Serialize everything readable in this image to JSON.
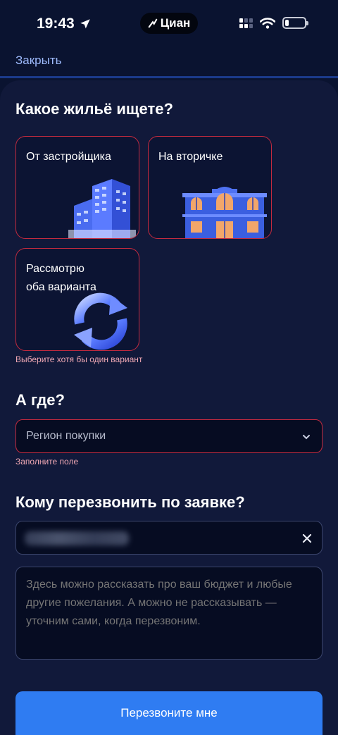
{
  "status_bar": {
    "time": "19:43",
    "app_name": "Циан",
    "icons": [
      "location-arrow-icon",
      "signal-icon",
      "wifi-icon",
      "battery-icon"
    ],
    "battery_level": 0.2
  },
  "header": {
    "close_label": "Закрыть"
  },
  "housing": {
    "title": "Какое жильё ищете?",
    "options": [
      {
        "label": "От застройщика",
        "icon": "new-building-icon"
      },
      {
        "label": "На вторичке",
        "icon": "classic-building-icon"
      },
      {
        "label": "Рассмотрю\nоба варианта",
        "icon": "refresh-arrows-icon"
      }
    ],
    "error": "Выберите хотя бы один вариант"
  },
  "location": {
    "title": "А где?",
    "placeholder": "Регион покупки",
    "error": "Заполните поле"
  },
  "contact": {
    "title": "Кому перезвонить по заявке?",
    "comment_placeholder": "Здесь можно рассказать про ваш бюджет и любые другие пожелания. А можно не рассказывать — уточним сами, когда перезвоним."
  },
  "submit_label": "Перезвоните мне",
  "colors": {
    "background": "#0a1330",
    "sheet": "#11193a",
    "accent": "#2f7cf2",
    "error": "#c42a3f",
    "link": "#9fbcff"
  }
}
